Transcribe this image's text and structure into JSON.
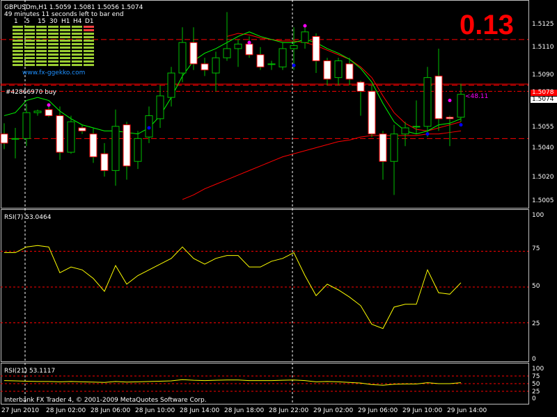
{
  "symbol_line": "GBPUSDm,H1  1.5059 1.5081 1.5056 1.5074",
  "timer_line": "49 minutes 11 seconds left to bar end",
  "spread": "0.13",
  "gekko_site": "www.fx-ggekko.com",
  "timeframes": [
    "1",
    "5",
    "15",
    "30",
    "H1",
    "H4",
    "D1"
  ],
  "order_label": "#42866970 buy",
  "order_tag": "<48.11",
  "price_axis": [
    "1.5125",
    "1.5110",
    "1.5090",
    "1.5074",
    "1.5055",
    "1.5040",
    "1.5020",
    "1.5005"
  ],
  "current_price": "1.5074",
  "order_price_tag": "1.5078",
  "rsi7_label": "RSI(7) 53.0464",
  "rsi7_axis": [
    "100",
    "75",
    "50",
    "25",
    "0"
  ],
  "rsi21_label": "RSI(21) 53.1117",
  "rsi21_axis": [
    "100",
    "75",
    "50",
    "25",
    "0"
  ],
  "copyright": "Interbank FX Trader 4, © 2001-2009 MetaQuotes Software Corp.",
  "time_axis": [
    "27 Jun 2010",
    "28 Jun 02:00",
    "28 Jun 06:00",
    "28 Jun 10:00",
    "28 Jun 14:00",
    "28 Jun 18:00",
    "28 Jun 22:00",
    "29 Jun 02:00",
    "29 Jun 06:00",
    "29 Jun 10:00",
    "29 Jun 14:00"
  ],
  "colors": {
    "bull_candle": "#ffffff",
    "bear_candle": "#ffffff",
    "grid_red": "#ff0000",
    "rsi_line": "#ffff00",
    "ma_slow": "#ff0000",
    "ma_fast": "#00ff00",
    "axis": "#c0c0c0"
  },
  "chart_data": {
    "type": "candlestick",
    "candles": [
      {
        "o": 1.5048,
        "h": 1.5055,
        "l": 1.5038,
        "c": 1.5042
      },
      {
        "o": 1.5045,
        "h": 1.5052,
        "l": 1.5032,
        "c": 1.5045
      },
      {
        "o": 1.5045,
        "h": 1.5068,
        "l": 1.504,
        "c": 1.5062
      },
      {
        "o": 1.5062,
        "h": 1.5064,
        "l": 1.506,
        "c": 1.5063
      },
      {
        "o": 1.5064,
        "h": 1.5066,
        "l": 1.5059,
        "c": 1.506
      },
      {
        "o": 1.506,
        "h": 1.5066,
        "l": 1.5031,
        "c": 1.5036
      },
      {
        "o": 1.5036,
        "h": 1.506,
        "l": 1.5035,
        "c": 1.5056
      },
      {
        "o": 1.5052,
        "h": 1.5054,
        "l": 1.5048,
        "c": 1.505
      },
      {
        "o": 1.5048,
        "h": 1.5052,
        "l": 1.5029,
        "c": 1.5033
      },
      {
        "o": 1.5035,
        "h": 1.5042,
        "l": 1.502,
        "c": 1.5024
      },
      {
        "o": 1.5024,
        "h": 1.5064,
        "l": 1.5014,
        "c": 1.5053
      },
      {
        "o": 1.5054,
        "h": 1.5056,
        "l": 1.5018,
        "c": 1.5027
      },
      {
        "o": 1.503,
        "h": 1.505,
        "l": 1.5025,
        "c": 1.5045
      },
      {
        "o": 1.5046,
        "h": 1.5066,
        "l": 1.5042,
        "c": 1.506
      },
      {
        "o": 1.5058,
        "h": 1.508,
        "l": 1.5052,
        "c": 1.5073
      },
      {
        "o": 1.5072,
        "h": 1.5092,
        "l": 1.5066,
        "c": 1.5088
      },
      {
        "o": 1.5088,
        "h": 1.5118,
        "l": 1.5082,
        "c": 1.5108
      },
      {
        "o": 1.5108,
        "h": 1.5118,
        "l": 1.509,
        "c": 1.5094
      },
      {
        "o": 1.5094,
        "h": 1.5098,
        "l": 1.5086,
        "c": 1.509
      },
      {
        "o": 1.5088,
        "h": 1.5102,
        "l": 1.5076,
        "c": 1.5098
      },
      {
        "o": 1.5098,
        "h": 1.5128,
        "l": 1.5096,
        "c": 1.5104
      },
      {
        "o": 1.5104,
        "h": 1.511,
        "l": 1.5092,
        "c": 1.5107
      },
      {
        "o": 1.5107,
        "h": 1.5112,
        "l": 1.5098,
        "c": 1.51
      },
      {
        "o": 1.51,
        "h": 1.5105,
        "l": 1.509,
        "c": 1.5092
      },
      {
        "o": 1.5094,
        "h": 1.5096,
        "l": 1.509,
        "c": 1.5094
      },
      {
        "o": 1.5092,
        "h": 1.5108,
        "l": 1.509,
        "c": 1.5104
      },
      {
        "o": 1.5104,
        "h": 1.5118,
        "l": 1.509,
        "c": 1.5106
      },
      {
        "o": 1.5108,
        "h": 1.512,
        "l": 1.5104,
        "c": 1.5115
      },
      {
        "o": 1.5112,
        "h": 1.5114,
        "l": 1.5088,
        "c": 1.5096
      },
      {
        "o": 1.5096,
        "h": 1.5098,
        "l": 1.508,
        "c": 1.5084
      },
      {
        "o": 1.5085,
        "h": 1.5098,
        "l": 1.508,
        "c": 1.5096
      },
      {
        "o": 1.5094,
        "h": 1.5098,
        "l": 1.508,
        "c": 1.5084
      },
      {
        "o": 1.5082,
        "h": 1.5083,
        "l": 1.506,
        "c": 1.5076
      },
      {
        "o": 1.5076,
        "h": 1.508,
        "l": 1.5046,
        "c": 1.5048
      },
      {
        "o": 1.5048,
        "h": 1.505,
        "l": 1.5018,
        "c": 1.503
      },
      {
        "o": 1.503,
        "h": 1.5054,
        "l": 1.5008,
        "c": 1.5048
      },
      {
        "o": 1.5048,
        "h": 1.5056,
        "l": 1.504,
        "c": 1.5052
      },
      {
        "o": 1.5053,
        "h": 1.507,
        "l": 1.5048,
        "c": 1.5053
      },
      {
        "o": 1.5053,
        "h": 1.5092,
        "l": 1.5046,
        "c": 1.5085
      },
      {
        "o": 1.5086,
        "h": 1.5104,
        "l": 1.505,
        "c": 1.5058
      },
      {
        "o": 1.5059,
        "h": 1.506,
        "l": 1.504,
        "c": 1.5058
      },
      {
        "o": 1.5059,
        "h": 1.5081,
        "l": 1.5056,
        "c": 1.5074
      }
    ],
    "ma_slow": [
      null,
      null,
      null,
      null,
      null,
      null,
      null,
      null,
      null,
      null,
      null,
      null,
      null,
      null,
      null,
      null,
      1.5005,
      1.5008,
      1.5012,
      1.5015,
      1.5018,
      1.5021,
      1.5024,
      1.5027,
      1.503,
      1.5033,
      1.5035,
      1.5037,
      1.5039,
      1.5041,
      1.5043,
      1.5044,
      1.5046,
      1.5047,
      1.5047,
      1.5047,
      1.5047,
      1.5047,
      1.5048,
      1.5048,
      1.5049,
      1.505
    ],
    "ma_fast": [
      1.506,
      1.5062,
      1.507,
      1.5072,
      1.507,
      1.5063,
      1.5058,
      1.5054,
      1.5052,
      1.505,
      1.505,
      1.5049,
      1.5048,
      1.5052,
      1.506,
      1.5072,
      1.5086,
      1.5096,
      1.5101,
      1.5104,
      1.5108,
      1.5112,
      1.5115,
      1.5112,
      1.511,
      1.5108,
      1.5108,
      1.511,
      1.5108,
      1.5104,
      1.5101,
      1.5097,
      1.5091,
      1.5082,
      1.5068,
      1.5056,
      1.505,
      1.5048,
      1.505,
      1.5054,
      1.5055,
      1.5058
    ],
    "ma_red_fast": [
      null,
      null,
      null,
      null,
      null,
      null,
      null,
      null,
      null,
      null,
      null,
      null,
      null,
      null,
      null,
      null,
      null,
      null,
      null,
      null,
      1.5112,
      1.5114,
      1.5113,
      1.5111,
      1.511,
      1.5109,
      1.5109,
      1.5108,
      1.5106,
      1.5103,
      1.51,
      1.5097,
      1.5092,
      1.5085,
      1.5073,
      1.5062,
      1.5055,
      1.5051,
      1.505,
      1.5052,
      1.5054,
      1.5056
    ],
    "price_min": 1.5,
    "price_max": 1.5135,
    "hlines": [
      1.511,
      1.508,
      1.5076,
      1.5045
    ],
    "order_price": 1.5078,
    "rsi7": [
      74,
      74,
      78,
      79,
      78,
      60,
      64,
      62,
      56,
      47,
      65,
      52,
      58,
      62,
      66,
      70,
      78,
      70,
      66,
      70,
      72,
      72,
      64,
      64,
      68,
      70,
      74,
      58,
      44,
      52,
      48,
      43,
      37,
      24,
      21,
      36,
      38,
      38,
      62,
      46,
      45,
      53
    ],
    "rsi21": [
      60,
      59,
      58,
      57,
      57,
      56,
      57,
      56,
      55,
      54,
      57,
      55,
      56,
      57,
      58,
      59,
      63,
      61,
      60,
      61,
      62,
      62,
      60,
      60,
      60,
      61,
      62,
      60,
      56,
      57,
      56,
      54,
      52,
      47,
      45,
      48,
      49,
      49,
      53,
      50,
      50,
      53
    ],
    "rsi_levels": [
      25,
      50,
      75
    ]
  }
}
